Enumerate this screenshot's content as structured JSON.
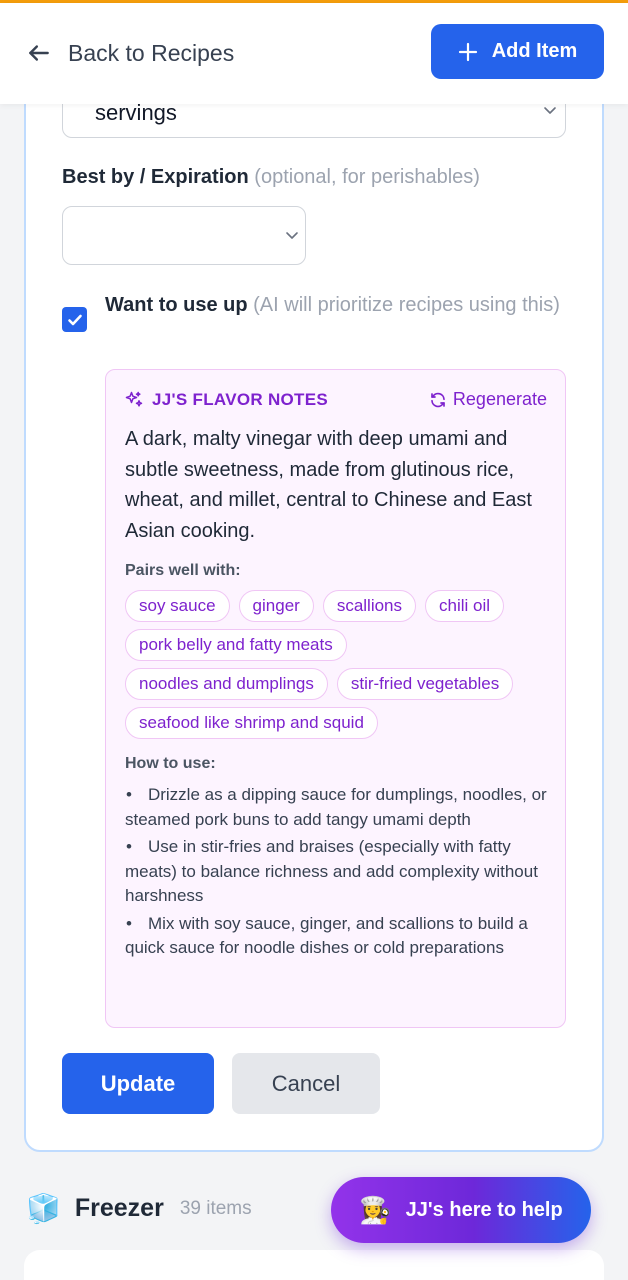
{
  "header": {
    "back_label": "Back to Recipes",
    "add_label": "Add Item"
  },
  "form": {
    "unit_value": "servings",
    "expiration_label": "Best by / Expiration",
    "expiration_hint": "(optional, for perishables)",
    "expiration_value": "",
    "want_label": "Want to use up",
    "want_hint": "(AI will prioritize recipes using this)",
    "want_checked": true
  },
  "flavor": {
    "title": "JJ'S FLAVOR NOTES",
    "regenerate_label": "Regenerate",
    "description": "A dark, malty vinegar with deep umami and subtle sweetness, made from glutinous rice, wheat, and millet, central to Chinese and East Asian cooking.",
    "pairs_heading": "Pairs well with:",
    "pairs": [
      "soy sauce",
      "ginger",
      "scallions",
      "chili oil",
      "pork belly and fatty meats",
      "noodles and dumplings",
      "stir-fried vegetables",
      "seafood like shrimp and squid"
    ],
    "howto_heading": "How to use:",
    "howto": [
      "Drizzle as a dipping sauce for dumplings, noodles, or steamed pork buns to add tangy umami depth",
      "Use in stir-fries and braises (especially with fatty meats) to balance richness and add complexity without harshness",
      "Mix with soy sauce, ginger, and scallions to build a quick sauce for noodle dishes or cold preparations"
    ]
  },
  "actions": {
    "update_label": "Update",
    "cancel_label": "Cancel"
  },
  "freezer": {
    "icon": "ice-cube-icon",
    "name": "Freezer",
    "count": "39 items"
  },
  "help": {
    "icon": "chef-icon",
    "label": "JJ's here to help"
  },
  "colors": {
    "primary": "#2563eb",
    "accent_purple": "#7e22ce",
    "top_accent": "#f59e0b"
  }
}
